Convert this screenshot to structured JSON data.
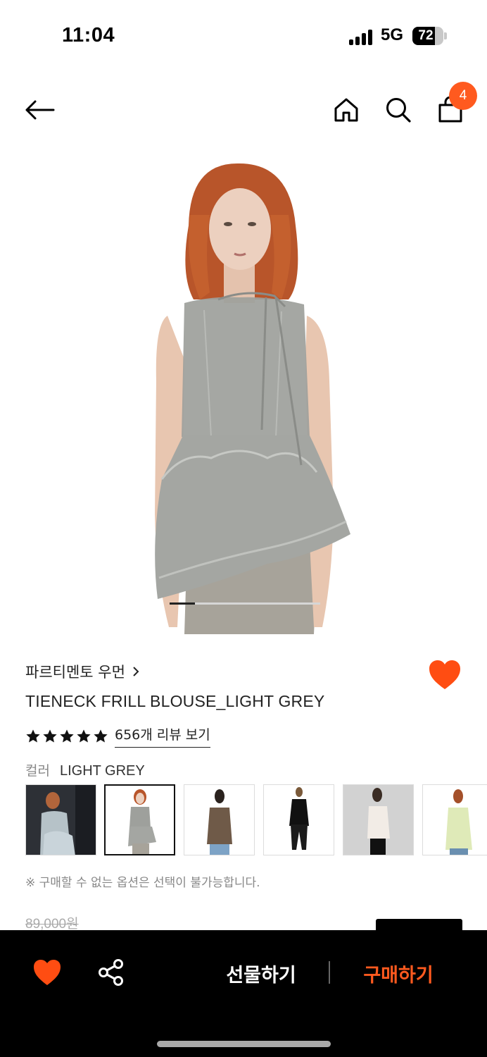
{
  "status_bar": {
    "time": "11:04",
    "network": "5G",
    "battery": "72",
    "battery_level": 0.72
  },
  "nav": {
    "cart_count": "4",
    "icons": [
      "back-arrow-icon",
      "home-icon",
      "search-icon",
      "shopping-bag-icon"
    ]
  },
  "gallery": {
    "progress": 0.17
  },
  "product": {
    "brand": "파르티멘토 우먼",
    "title": "TIENECK FRILL BLOUSE_LIGHT GREY",
    "rating_stars": 5,
    "review_link": "656개 리뷰 보기",
    "option_label": "컬러",
    "option_value": "LIGHT GREY",
    "swatch_count": 6,
    "selected_swatch": 1,
    "notice": "※ 구매할 수 없는 옵션은 선택이 불가능합니다.",
    "original_price": "89,000원"
  },
  "bottom_bar": {
    "gift_label": "선물하기",
    "buy_label": "구매하기"
  },
  "colors": {
    "accent": "#ff5a1f",
    "heart": "#ff4d12",
    "bar_background": "#000000"
  }
}
